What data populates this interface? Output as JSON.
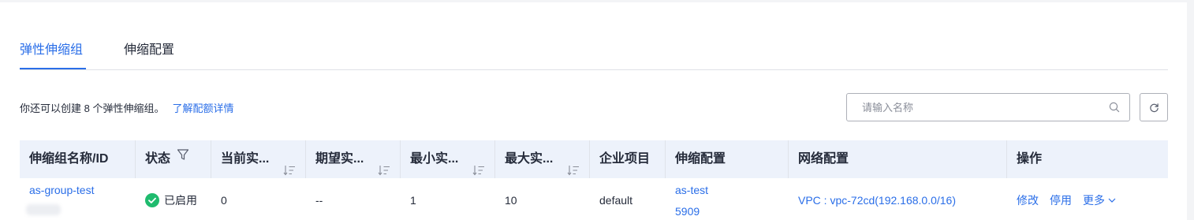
{
  "tabs": [
    {
      "label": "弹性伸缩组",
      "active": true
    },
    {
      "label": "伸缩配置",
      "active": false
    }
  ],
  "quota": {
    "text": "你还可以创建 8 个弹性伸缩组。",
    "link": "了解配额详情"
  },
  "search": {
    "placeholder": "请输入名称",
    "value": ""
  },
  "colors": {
    "accent": "#2a6ee8",
    "success": "#1fbb6e",
    "header_bg": "#edf2fb"
  },
  "table": {
    "headers": {
      "name": "伸缩组名称/ID",
      "status": "状态",
      "current": "当前实...",
      "desired": "期望实...",
      "min": "最小实...",
      "max": "最大实...",
      "project": "企业项目",
      "config": "伸缩配置",
      "network": "网络配置",
      "ops": "操作"
    },
    "rows": [
      {
        "name": "as-group-test",
        "status": "已启用",
        "current": "0",
        "desired": "--",
        "min": "1",
        "max": "10",
        "project": "default",
        "config_line1": "as-test",
        "config_line2": "5909",
        "network": "VPC : vpc-72cd(192.168.0.0/16)",
        "op_modify": "修改",
        "op_disable": "停用",
        "op_more": "更多"
      }
    ]
  },
  "icons": {
    "search": "search-icon",
    "refresh": "refresh-icon",
    "filter": "filter-icon",
    "sort": "sort-icon",
    "status": "check-circle-icon",
    "more": "chevron-down-icon"
  }
}
